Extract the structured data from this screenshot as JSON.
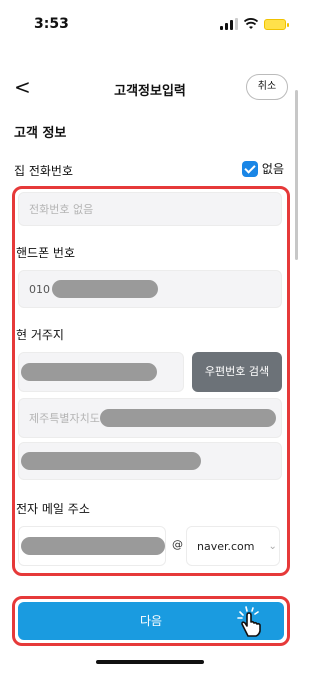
{
  "status": {
    "time": "3:53"
  },
  "nav": {
    "title": "고객정보입력",
    "cancel": "취소",
    "back": "<"
  },
  "section": {
    "title": "고객 정보"
  },
  "home_phone": {
    "label": "집 전화번호",
    "none_label": "없음",
    "placeholder": "전화번호 없음",
    "none_checked": true
  },
  "mobile": {
    "label": "핸드폰 번호",
    "prefix": "010"
  },
  "address": {
    "label": "현 거주지",
    "zip_button": "우편번호 검색",
    "line1_prefix": "제주특별자치도"
  },
  "email": {
    "label": "전자 메일 주소",
    "at": "@",
    "domain": "naver.com"
  },
  "next_button": {
    "label": "다음"
  },
  "colors": {
    "accent": "#1a9be0",
    "highlight": "#e63939",
    "checkbox": "#1a86e6"
  }
}
